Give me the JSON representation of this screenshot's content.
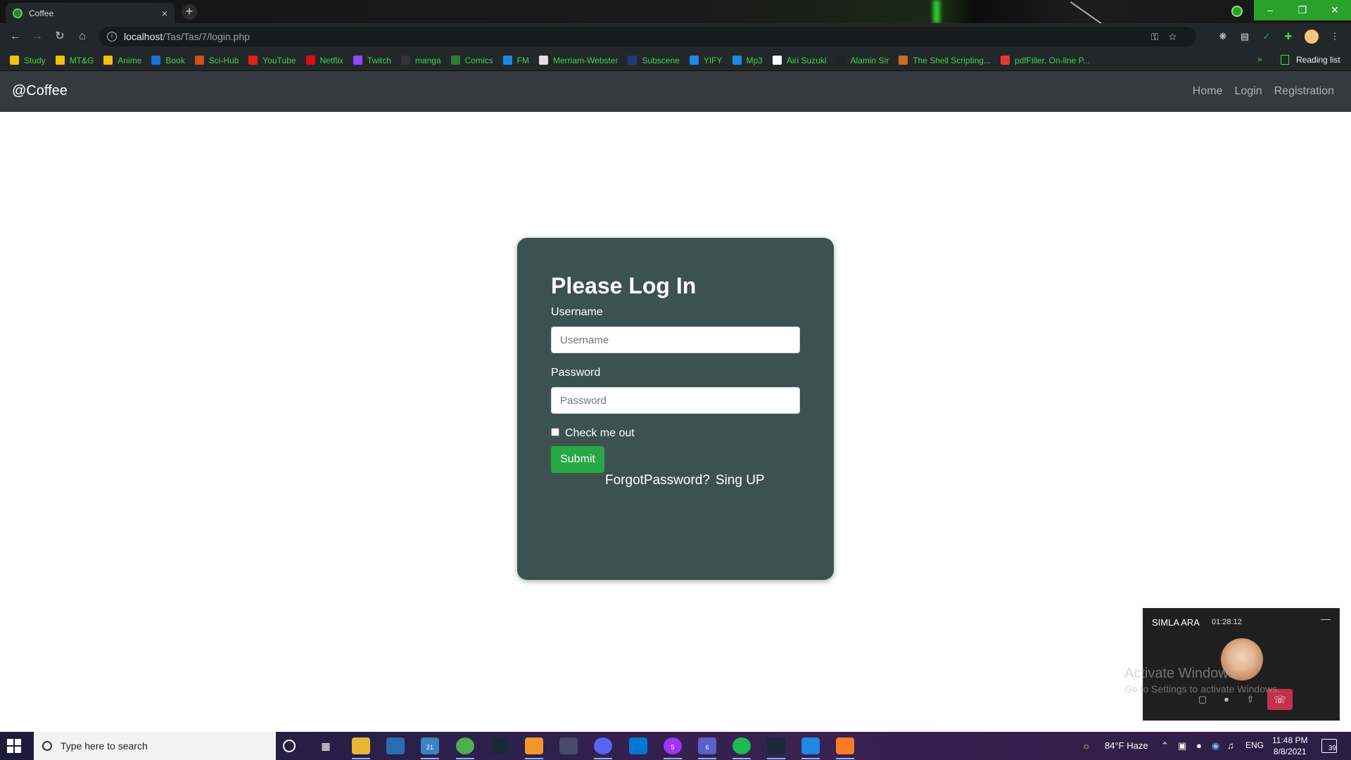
{
  "browser": {
    "tab_title": "Coffee",
    "tab_close": "×",
    "new_tab": "+",
    "url_host": "localhost",
    "url_path": "/Tas/Tas/7/login.php",
    "bookmarks": [
      {
        "label": "Study",
        "color": "#f4c20d"
      },
      {
        "label": "MT&G",
        "color": "#f4c20d"
      },
      {
        "label": "Anime",
        "color": "#f4c20d"
      },
      {
        "label": "Book",
        "color": "#1f6fd1"
      },
      {
        "label": "Sci-Hub",
        "color": "#d94a1e"
      },
      {
        "label": "YouTube",
        "color": "#e62117"
      },
      {
        "label": "Netflix",
        "color": "#e50914"
      },
      {
        "label": "Twitch",
        "color": "#9146ff"
      },
      {
        "label": "manga",
        "color": "#333333"
      },
      {
        "label": "Comics",
        "color": "#2e7d32"
      },
      {
        "label": "FM",
        "color": "#1e88e5"
      },
      {
        "label": "Merriam-Webster",
        "color": "#e0e0e0"
      },
      {
        "label": "Subscene",
        "color": "#1f3a7a"
      },
      {
        "label": "YIFY",
        "color": "#1e88e5"
      },
      {
        "label": "Mp3",
        "color": "#1e88e5"
      },
      {
        "label": "Airi Suzuki",
        "color": "#ffffff"
      },
      {
        "label": "Alamin Sir",
        "color": "#222222"
      },
      {
        "label": "The Shell Scripting...",
        "color": "#d2691e"
      },
      {
        "label": "pdfFiller. On-line P...",
        "color": "#e53935"
      }
    ],
    "bookmarks_more": "»",
    "reading_list": "Reading list"
  },
  "site": {
    "brand": "@Coffee",
    "nav": {
      "home": "Home",
      "login": "Login",
      "registration": "Registration"
    }
  },
  "login": {
    "heading": "Please Log In",
    "username_label": "Username",
    "username_placeholder": "Username",
    "password_label": "Password",
    "password_placeholder": "Password",
    "check_label": "Check me out",
    "submit": "Submit",
    "forgot": "ForgotPassword?",
    "signup": "Sing UP"
  },
  "call": {
    "name": "SIMLA ARA",
    "duration": "01:28:12",
    "minimize": "—"
  },
  "watermark": {
    "line1": "Activate Windows",
    "line2": "Go to Settings to activate Windows."
  },
  "taskbar": {
    "search_placeholder": "Type here to search",
    "mail_badge": "21",
    "messenger_badge": "5",
    "teams_badge": "6",
    "weather": "84°F  Haze",
    "language": "ENG",
    "time": "11:48 PM",
    "date": "8/8/2021",
    "notifications": "39"
  }
}
